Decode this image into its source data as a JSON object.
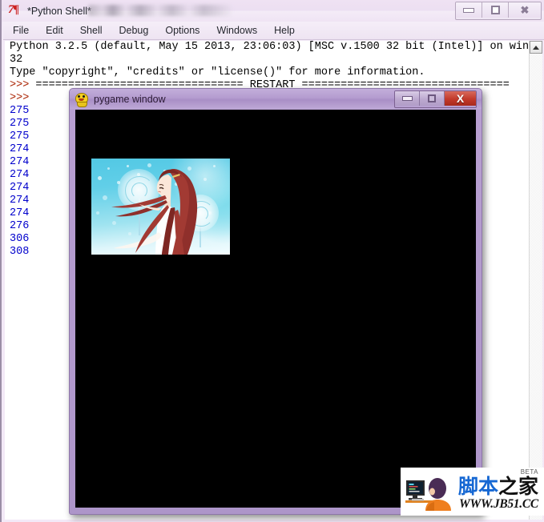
{
  "idle": {
    "title": "*Python Shell*",
    "title_blurred_suffix": "",
    "logo_text": "7¶",
    "menu": [
      {
        "label": "File"
      },
      {
        "label": "Edit"
      },
      {
        "label": "Shell"
      },
      {
        "label": "Debug"
      },
      {
        "label": "Options"
      },
      {
        "label": "Windows"
      },
      {
        "label": "Help"
      }
    ],
    "window_buttons": {
      "minimize": "–",
      "maximize": "□",
      "close": "✕"
    },
    "shell_lines": [
      {
        "text": "Python 3.2.5 (default, May 15 2013, 23:06:03) [MSC v.1500 32 bit (Intel)] on win",
        "kind": "normal"
      },
      {
        "text": "32",
        "kind": "normal"
      },
      {
        "text": "Type \"copyright\", \"credits\" or \"license()\" for more information.",
        "kind": "normal"
      },
      {
        "text": ">>> ================================ RESTART ================================",
        "kind": "restart"
      },
      {
        "text": ">>> ",
        "kind": "prompt"
      },
      {
        "text": "275",
        "kind": "out"
      },
      {
        "text": "275",
        "kind": "out"
      },
      {
        "text": "275",
        "kind": "out"
      },
      {
        "text": "274",
        "kind": "out"
      },
      {
        "text": "274",
        "kind": "out"
      },
      {
        "text": "274",
        "kind": "out"
      },
      {
        "text": "274",
        "kind": "out"
      },
      {
        "text": "274",
        "kind": "out"
      },
      {
        "text": "274",
        "kind": "out"
      },
      {
        "text": "276",
        "kind": "out"
      },
      {
        "text": "306",
        "kind": "out"
      },
      {
        "text": "308",
        "kind": "out"
      }
    ],
    "scrollbar": {
      "up_arrow": "▲"
    }
  },
  "pygame": {
    "title": "pygame window",
    "icon_name": "pygame-mascot-icon",
    "window_buttons": {
      "minimize": "–",
      "maximize": "□",
      "close": "X"
    },
    "surface": {
      "background_color": "#000000",
      "image_alt": "anime girl with long auburn hair and white dress on cyan background with dandelion puffs"
    }
  },
  "watermark": {
    "beta": "BETA",
    "site_name_blue": "脚本",
    "site_name_black": "之家",
    "url": "WWW.JB51.CC"
  },
  "colors": {
    "idle_chrome": "#efe4f4",
    "pygame_chrome": "#b49ccf",
    "output_blue": "#0000cc",
    "prompt_red": "#aa2200",
    "close_red": "#c2392a",
    "canvas_black": "#000000",
    "watermark_blue": "#1567d3"
  }
}
